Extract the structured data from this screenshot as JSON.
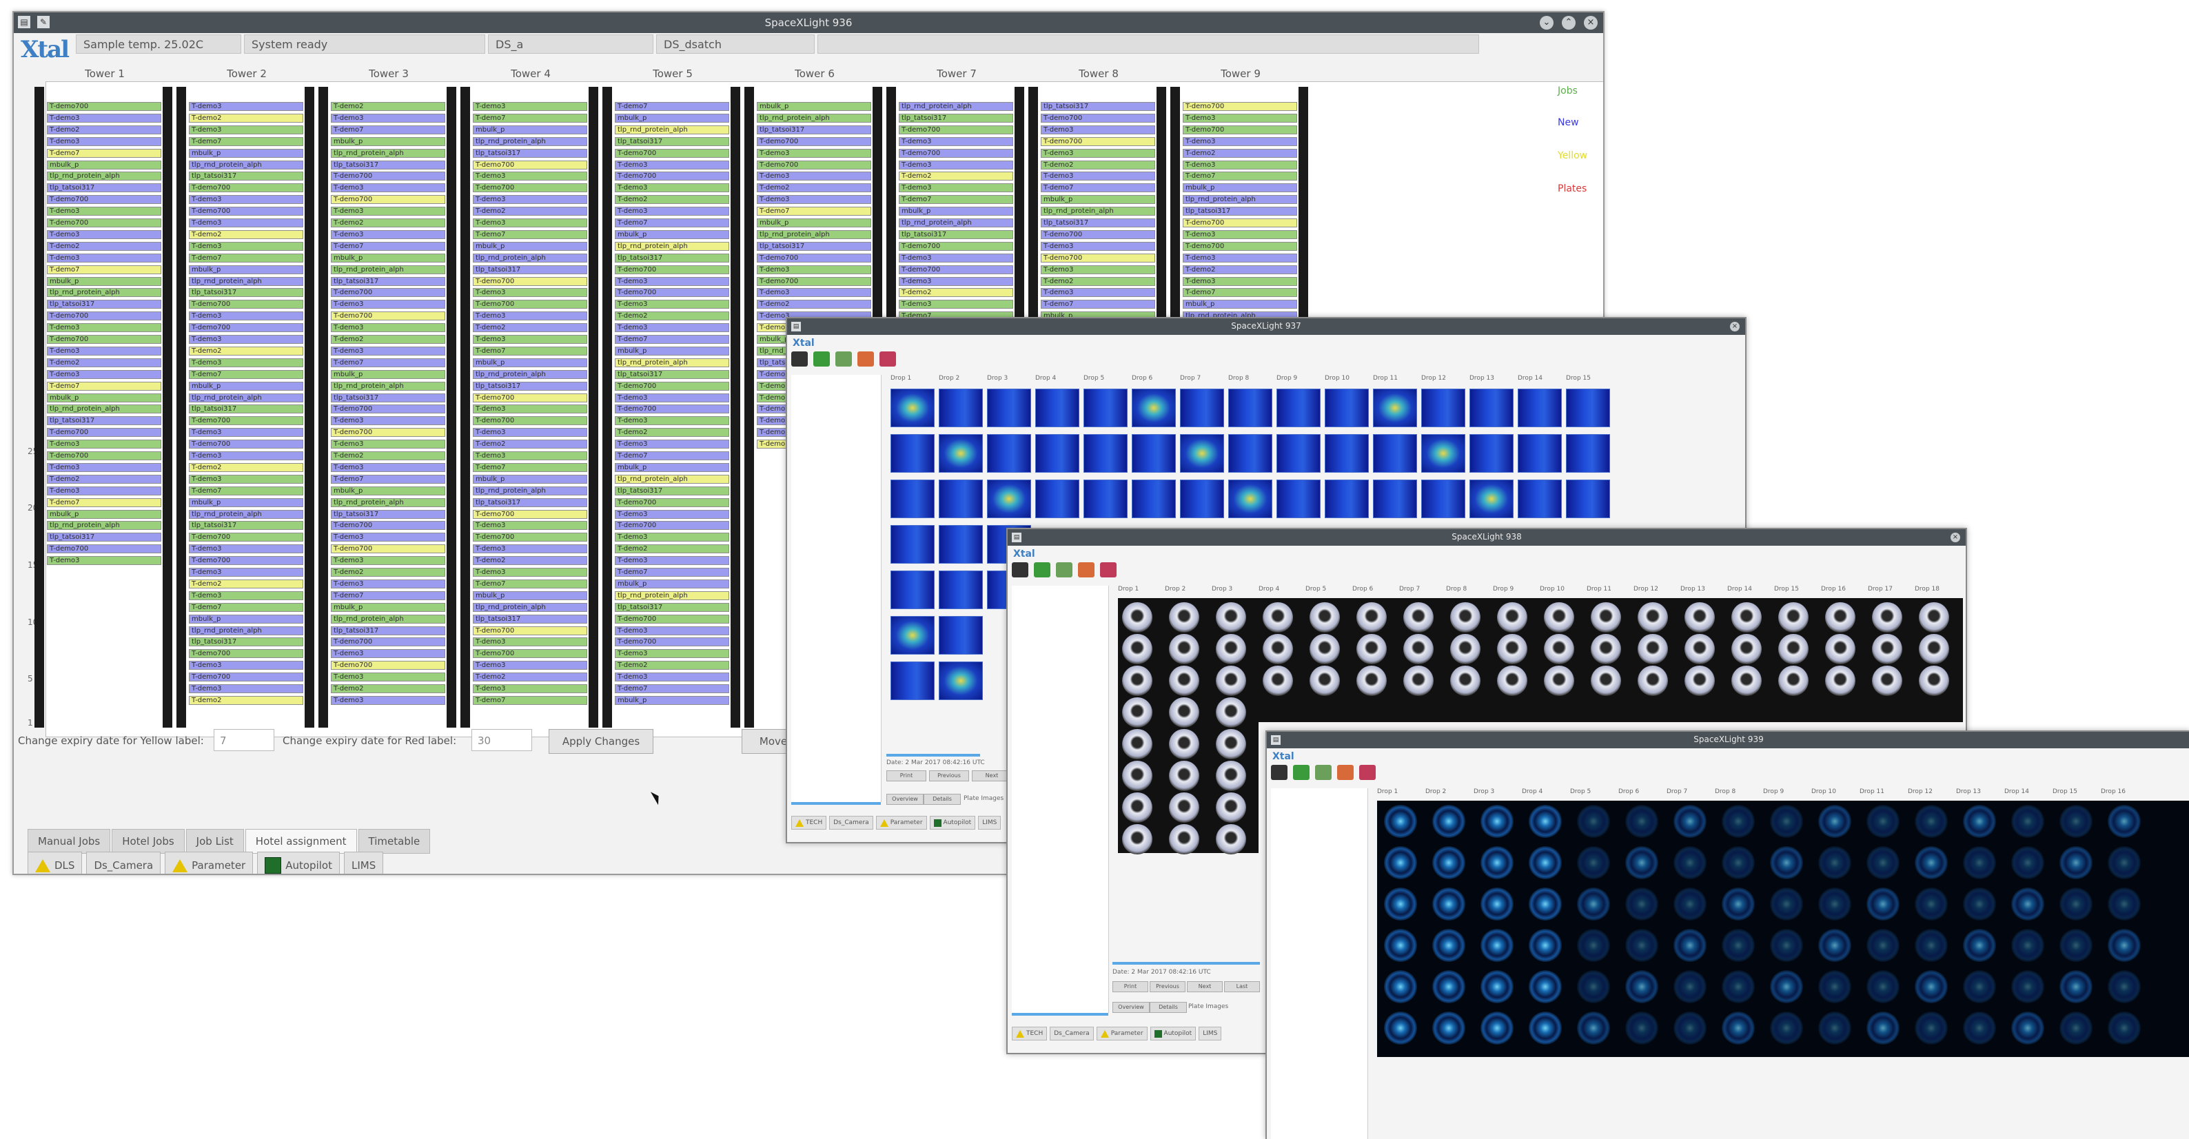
{
  "colors": {
    "jobs": "#9ad07c",
    "new": "#9b9bf0",
    "yellow": "#eef08a",
    "plates": "#e05050",
    "accent": "#3f7fc3"
  },
  "main_window": {
    "title": "SpaceXLight 936",
    "logo": "Xtal",
    "info_fields": [
      "Sample temp. 25.02C",
      "System ready",
      "DS_a",
      "DS_dsatch"
    ],
    "towers": [
      "Tower 1",
      "Tower 2",
      "Tower 3",
      "Tower 4",
      "Tower 5",
      "Tower 6",
      "Tower 7",
      "Tower 8",
      "Tower 9"
    ],
    "slot_labels": [
      "T-demo700",
      "T-demo3",
      "T-demo2",
      "T-demo3",
      "T-demo7",
      "mbulk_p",
      "tlp_rnd_protein_alph",
      "tlp_tatsoi317",
      "T-demo700",
      "T-demo3"
    ],
    "y_ticks": [
      "25",
      "20",
      "15",
      "10",
      "5",
      "1"
    ],
    "legend": [
      "Jobs",
      "New",
      "Yellow",
      "Plates"
    ],
    "controls": {
      "yellow_label": "Change expiry date for Yellow label:",
      "yellow_value": "7",
      "red_label": "Change expiry date for Red label:",
      "red_value": "30",
      "apply_button": "Apply Changes",
      "move_button": "Move"
    },
    "tabs": [
      "Manual Jobs",
      "Hotel Jobs",
      "Job List",
      "Hotel assignment",
      "Timetable"
    ],
    "active_tab": "Hotel assignment",
    "status_bar": [
      "DLS",
      "Ds_Camera",
      "Parameter",
      "Autopilot",
      "LIMS"
    ]
  },
  "sub_windows": [
    {
      "title": "SpaceXLight 937",
      "logo": "Xtal",
      "kind": "heatmap",
      "date": "Date: 2 Mar 2017 08:42:16 UTC",
      "buttons": [
        "Print",
        "Previous",
        "Next"
      ],
      "tabs": [
        "Overview",
        "Details"
      ],
      "grid_label": "Plate Images",
      "status": [
        "TECH",
        "Ds_Camera",
        "Parameter",
        "Autopilot",
        "LIMS"
      ]
    },
    {
      "title": "SpaceXLight 938",
      "logo": "Xtal",
      "kind": "wells",
      "date": "Date: 2 Mar 2017 08:42:16 UTC",
      "buttons": [
        "Print",
        "Previous",
        "Next",
        "Last"
      ],
      "tabs": [
        "Overview",
        "Details"
      ],
      "grid_label": "Plate Images",
      "status": [
        "TECH",
        "Ds_Camera",
        "Parameter",
        "Autopilot",
        "LIMS"
      ]
    },
    {
      "title": "SpaceXLight 939",
      "logo": "Xtal",
      "kind": "fluor"
    }
  ]
}
